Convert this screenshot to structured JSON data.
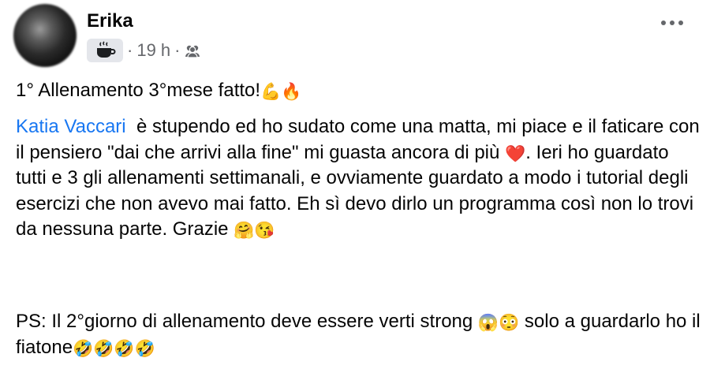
{
  "post": {
    "author": "Erika",
    "time": "19 h",
    "separator": "·",
    "mood_icon": "coffee-cup-icon",
    "audience_icon": "friends-icon",
    "menu_icon": "more-options-icon",
    "title": "1° Allenamento 3°mese fatto!",
    "title_emojis": [
      "💪",
      "🔥"
    ],
    "mention": "Katia Vaccari",
    "p2_a": "è stupendo ed ho sudato come una matta, mi piace e il faticare con il pensiero \"dai che arrivi alla fine\" mi guasta ancora di più",
    "p2_emoji_heart": "❤️",
    "p2_b": ". Ieri ho guardato tutti e 3 gli allenamenti settimanali, e ovviamente guardato a modo i tutorial degli esercizi che non avevo mai fatto. Eh sì devo dirlo un programma così non lo trovi da nessuna parte. Grazie",
    "p2_emojis_end": [
      "🤗",
      "😘"
    ],
    "p3_a": "PS: Il 2°giorno di allenamento deve essere verti strong",
    "p3_emojis_mid": [
      "😱",
      "😳"
    ],
    "p3_b": "solo a guardarlo ho il fiatone",
    "p3_emojis_end": [
      "🤣",
      "🤣",
      "🤣",
      "🤣"
    ]
  },
  "colors": {
    "text": "#050505",
    "secondary": "#65676b",
    "link": "#1877f2",
    "mood_bg": "#e4e6eb"
  }
}
